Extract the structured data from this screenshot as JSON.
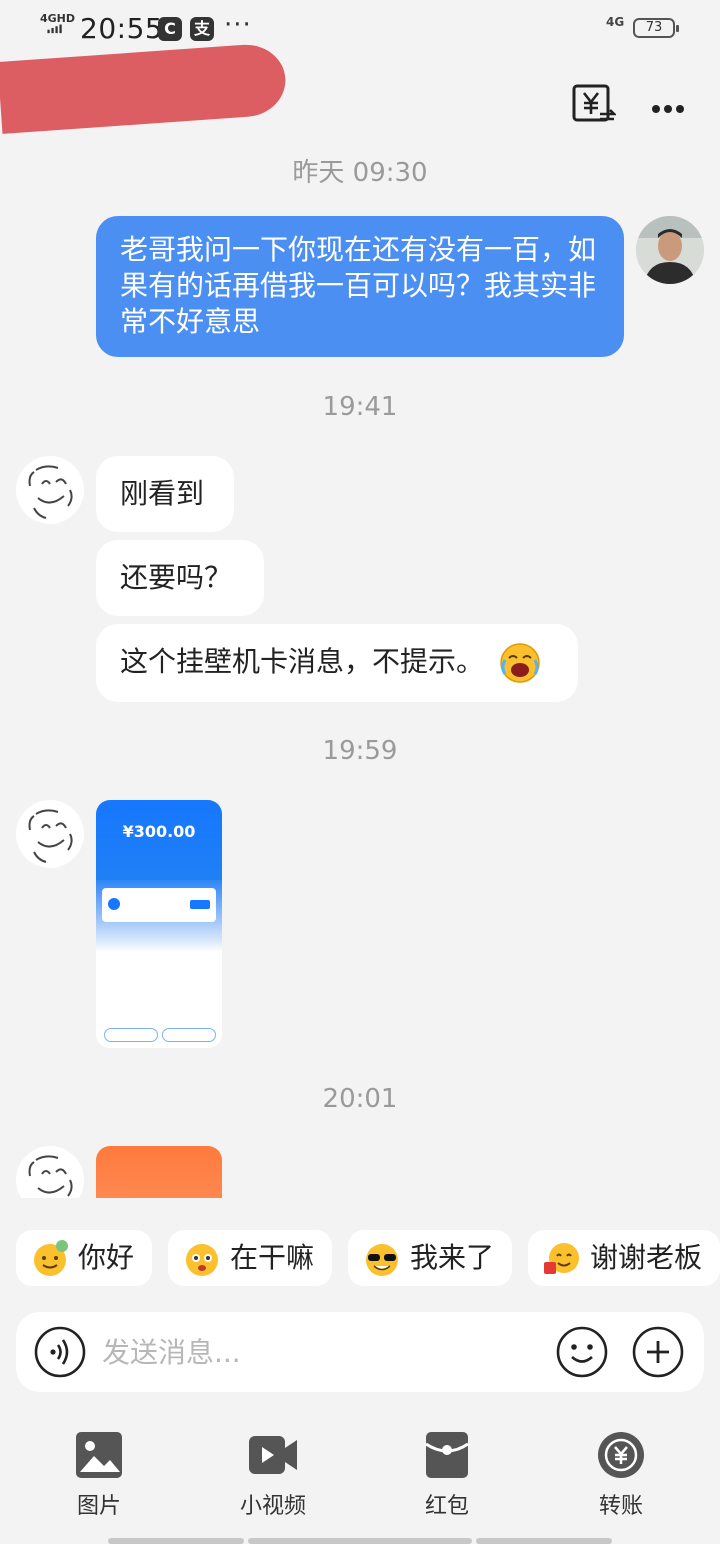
{
  "status_bar": {
    "network": "4GHD",
    "time": "20:55",
    "app_icon_1": "C",
    "app_icon_2": "支",
    "more": "···",
    "cell": "4G",
    "battery": "73"
  },
  "header": {
    "contact_name": "",
    "transfer_icon": "yuan-transfer-icon",
    "more_icon": "ellipsis-icon"
  },
  "chat": {
    "messages": [
      {
        "type": "timestamp",
        "text": "昨天 09:30"
      },
      {
        "type": "text",
        "from": "me",
        "text": "老哥我问一下你现在还有没有一百，如果有的话再借我一百可以吗？我其实非常不好意思"
      },
      {
        "type": "timestamp",
        "text": "19:41"
      },
      {
        "type": "text",
        "from": "peer",
        "text": "刚看到"
      },
      {
        "type": "text",
        "from": "peer",
        "text": "还要吗？"
      },
      {
        "type": "text",
        "from": "peer",
        "text": "这个挂壁机卡消息，不提示。",
        "emoji": "laughing-crying-emoji"
      },
      {
        "type": "timestamp",
        "text": "19:59"
      },
      {
        "type": "image",
        "from": "peer",
        "amount": "¥300.00"
      },
      {
        "type": "timestamp",
        "text": "20:01"
      },
      {
        "type": "image",
        "from": "peer",
        "theme": "orange"
      }
    ]
  },
  "quick_replies": [
    {
      "label": "你好",
      "icon": "hi-emoji"
    },
    {
      "label": "在干嘛",
      "icon": "wondering-emoji"
    },
    {
      "label": "我来了",
      "icon": "sunglasses-emoji"
    },
    {
      "label": "谢谢老板",
      "icon": "thanks-emoji"
    }
  ],
  "input": {
    "placeholder": "发送消息..."
  },
  "tools": [
    {
      "label": "图片",
      "icon": "image-icon"
    },
    {
      "label": "小视频",
      "icon": "video-icon"
    },
    {
      "label": "红包",
      "icon": "red-packet-icon"
    },
    {
      "label": "转账",
      "icon": "transfer-icon"
    }
  ],
  "colors": {
    "accent_blue": "#4c8ff3",
    "background": "#f3f3f3",
    "redaction": "#dc5e63"
  }
}
